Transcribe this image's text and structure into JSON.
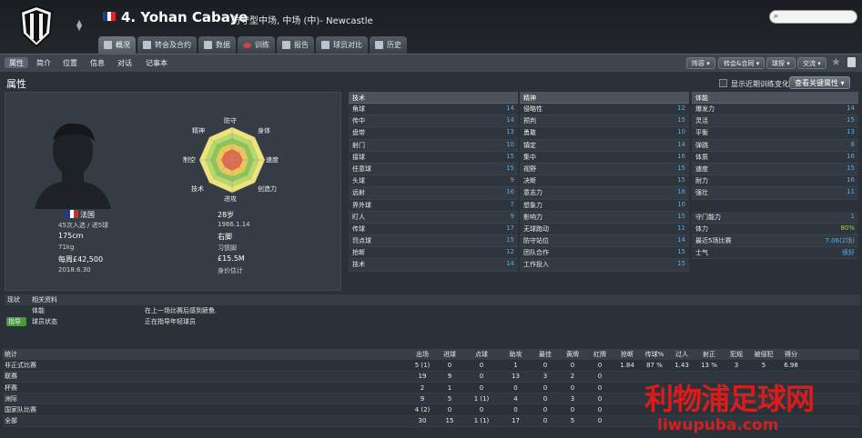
{
  "header": {
    "player_name": "4. Yohan Cabaye",
    "position": "防守型中场, 中场 (中)- Newcastle",
    "search_icon": "⌕"
  },
  "tabs": [
    "概况",
    "转会及合约",
    "数据",
    "训练",
    "报告",
    "球员对比",
    "历史"
  ],
  "subtabs": [
    "属性",
    "简介",
    "位置",
    "信息",
    "对话",
    "记事本"
  ],
  "toolbar": [
    "阵容",
    "转会&合同",
    "球探",
    "交流"
  ],
  "section": {
    "title": "属性",
    "show_changes": "显示近期训练变化",
    "view_key": "查看关键属性"
  },
  "profile": {
    "nation": "法国",
    "caps": "45次入选 / 进5球",
    "height": "175cm",
    "weight": "71kg",
    "wage": "每周£42,500",
    "contract": "2018.6.30",
    "age": "28岁",
    "birth": "1986.1.14",
    "foot": "右脚",
    "foot_label": "习惯脚",
    "value": "£15.5M",
    "value_label": "身价估计"
  },
  "radar": {
    "top": "防守",
    "top_right": "身体",
    "right": "速度",
    "bottom_right": "创造力",
    "bottom": "进攻",
    "bottom_left": "技术",
    "left": "制空",
    "top_left": "精神"
  },
  "technical": {
    "title": "技术",
    "rows": [
      [
        "角球",
        "14"
      ],
      [
        "传中",
        "14"
      ],
      [
        "盘带",
        "13"
      ],
      [
        "射门",
        "10"
      ],
      [
        "接球",
        "15"
      ],
      [
        "任意球",
        "15"
      ],
      [
        "头球",
        "9"
      ],
      [
        "远射",
        "16"
      ],
      [
        "界外球",
        "7"
      ],
      [
        "盯人",
        "9"
      ],
      [
        "传球",
        "17"
      ],
      [
        "罚点球",
        "15"
      ],
      [
        "抢断",
        "12"
      ],
      [
        "技术",
        "14"
      ]
    ]
  },
  "mental": {
    "title": "精神",
    "rows": [
      [
        "侵略性",
        "12"
      ],
      [
        "预判",
        "15"
      ],
      [
        "勇敢",
        "10"
      ],
      [
        "镇定",
        "14"
      ],
      [
        "集中",
        "16"
      ],
      [
        "视野",
        "15"
      ],
      [
        "决断",
        "15"
      ],
      [
        "意志力",
        "16"
      ],
      [
        "想象力",
        "10"
      ],
      [
        "影响力",
        "15"
      ],
      [
        "无球跑动",
        "11"
      ],
      [
        "防守站位",
        "14"
      ],
      [
        "团队合作",
        "15"
      ],
      [
        "工作投入",
        "15"
      ]
    ]
  },
  "physical": {
    "title": "体能",
    "rows": [
      [
        "爆发力",
        "14"
      ],
      [
        "灵活",
        "15"
      ],
      [
        "平衡",
        "13"
      ],
      [
        "弹跳",
        "8"
      ],
      [
        "体质",
        "16"
      ],
      [
        "速度",
        "15"
      ],
      [
        "耐力",
        "16"
      ],
      [
        "强壮",
        "11"
      ],
      [
        "",
        ""
      ],
      [
        "守门能力",
        "1"
      ],
      [
        "体力",
        "80%"
      ],
      [
        "最近5场比赛",
        "7.06(2场)"
      ],
      [
        "士气",
        "很好"
      ]
    ]
  },
  "status": {
    "tab1": "现状",
    "tab2": "相关资料",
    "rows": [
      [
        "",
        "体能",
        "在上一场比赛后感到疲惫."
      ],
      [
        "指导",
        "球员状态",
        "正在指导年轻球员"
      ]
    ]
  },
  "stats": {
    "headers": [
      "统计",
      "出场",
      "进球",
      "点球",
      "助攻",
      "最佳",
      "黄牌",
      "红牌",
      "抢断",
      "传球%",
      "过人",
      "射正",
      "犯规",
      "被侵犯",
      "得分"
    ],
    "rows": [
      [
        "非正式比赛",
        "5 (1)",
        "0",
        "0",
        "1",
        "0",
        "0",
        "0",
        "1.84",
        "87 %",
        "1.43",
        "13 %",
        "3",
        "5",
        "6.98"
      ],
      [
        "联赛",
        "19",
        "9",
        "0",
        "13",
        "3",
        "2",
        "0",
        "",
        "",
        "",
        "",
        "",
        "",
        ""
      ],
      [
        "杯赛",
        "2",
        "1",
        "0",
        "0",
        "0",
        "0",
        "0",
        "",
        "",
        "",
        "",
        "",
        "",
        ""
      ],
      [
        "洲际",
        "9",
        "5",
        "1 (1)",
        "4",
        "0",
        "3",
        "0",
        "",
        "",
        "",
        "",
        "",
        "",
        ""
      ],
      [
        "国家队比赛",
        "4 (2)",
        "0",
        "0",
        "0",
        "0",
        "0",
        "0",
        "",
        "",
        "",
        "",
        "",
        "",
        ""
      ],
      [
        "全部",
        "30",
        "15",
        "1 (1)",
        "17",
        "0",
        "5",
        "0",
        "",
        "",
        "",
        "",
        "",
        "",
        ""
      ]
    ]
  },
  "watermark": {
    "line1": "利物浦足球网",
    "line2": "liwupuba.com"
  },
  "colors": {
    "flag_blue": "#1f3a93",
    "flag_white": "#ffffff",
    "flag_red": "#d62828",
    "accent_blue": "#5fa9e0",
    "watermark": "#d91c1c"
  }
}
